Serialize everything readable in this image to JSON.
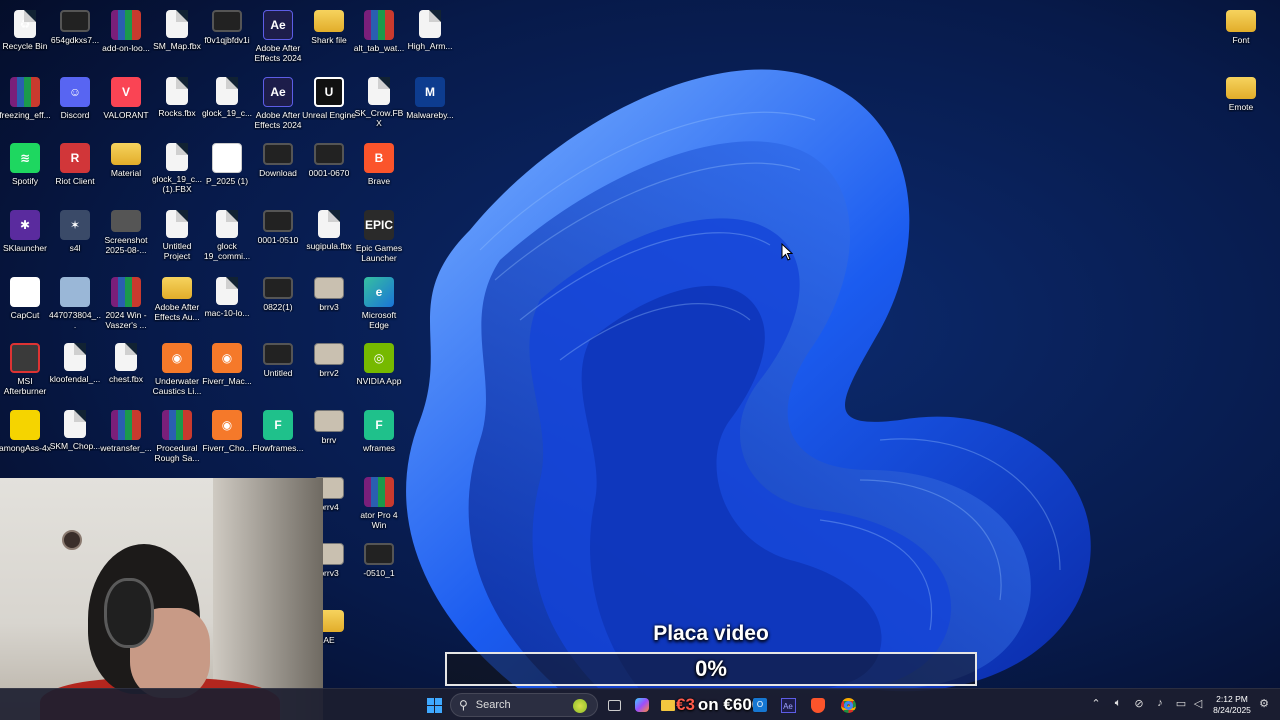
{
  "desktop": {
    "icons": [
      {
        "label": "Recycle Bin",
        "icon": "recycle-bin-icon",
        "type": "doc",
        "glyph": "♻"
      },
      {
        "label": "654gdkxs7...",
        "icon": "video-file-icon",
        "type": "video",
        "glyph": ""
      },
      {
        "label": "add-on-loo...",
        "icon": "winrar-icon",
        "type": "rar",
        "glyph": ""
      },
      {
        "label": "SM_Map.fbx",
        "icon": "file-icon",
        "type": "doc",
        "glyph": ""
      },
      {
        "label": "f0v1qjbfdv1i",
        "icon": "video-file-icon",
        "type": "video",
        "glyph": ""
      },
      {
        "label": "Adobe After Effects 2024",
        "icon": "after-effects-icon",
        "type": "ae",
        "glyph": "Ae"
      },
      {
        "label": "Shark file",
        "icon": "folder-icon",
        "type": "folder",
        "glyph": ""
      },
      {
        "label": "alt_tab_wat...",
        "icon": "winrar-icon",
        "type": "rar",
        "glyph": ""
      },
      {
        "label": "High_Arm...",
        "icon": "file-icon",
        "type": "doc",
        "glyph": ""
      },
      {
        "label": "freezing_eff...",
        "icon": "winrar-icon",
        "type": "rar",
        "glyph": ""
      },
      {
        "label": "Discord",
        "icon": "discord-icon",
        "type": "discord",
        "glyph": "☺"
      },
      {
        "label": "VALORANT",
        "icon": "valorant-icon",
        "type": "valorant",
        "glyph": "V"
      },
      {
        "label": "Rocks.fbx",
        "icon": "file-icon",
        "type": "doc",
        "glyph": ""
      },
      {
        "label": "glock_19_c...",
        "icon": "file-icon",
        "type": "doc",
        "glyph": ""
      },
      {
        "label": "Adobe After Effects 2024",
        "icon": "after-effects-icon",
        "type": "ae",
        "glyph": "Ae"
      },
      {
        "label": "Unreal Engine",
        "icon": "unreal-engine-icon",
        "type": "unreal",
        "glyph": "U"
      },
      {
        "label": "SK_Crow.FBX",
        "icon": "file-icon",
        "type": "doc",
        "glyph": ""
      },
      {
        "label": "Malwareby...",
        "icon": "malwarebytes-icon",
        "type": "malware",
        "glyph": "M"
      },
      {
        "label": "Spotify",
        "icon": "spotify-icon",
        "type": "spotify",
        "glyph": "≋"
      },
      {
        "label": "Riot Client",
        "icon": "riot-client-icon",
        "type": "riot",
        "glyph": "R"
      },
      {
        "label": "Material",
        "icon": "folder-icon",
        "type": "folder",
        "glyph": ""
      },
      {
        "label": "glock_19_c... (1).FBX",
        "icon": "file-icon",
        "type": "doc",
        "glyph": ""
      },
      {
        "label": "P_2025 (1)",
        "icon": "pdf-icon",
        "type": "pdf",
        "glyph": "▼"
      },
      {
        "label": "Download",
        "icon": "video-file-icon",
        "type": "video",
        "glyph": ""
      },
      {
        "label": "0001-0670",
        "icon": "video-file-icon",
        "type": "video",
        "glyph": ""
      },
      {
        "label": "Brave",
        "icon": "brave-icon",
        "type": "brave",
        "glyph": "B"
      },
      {
        "label": "SKlauncher",
        "icon": "sklauncher-icon",
        "type": "sklaunch",
        "glyph": "✱"
      },
      {
        "label": "s4l",
        "icon": "s4l-icon",
        "type": "s4l",
        "glyph": "✶"
      },
      {
        "label": "Screenshot 2025-08-...",
        "icon": "screenshot-icon",
        "type": "shot",
        "glyph": ""
      },
      {
        "label": "Untitled Project",
        "icon": "file-icon",
        "type": "doc",
        "glyph": ""
      },
      {
        "label": "glock 19_commi...",
        "icon": "file-icon",
        "type": "doc",
        "glyph": ""
      },
      {
        "label": "0001-0510",
        "icon": "video-file-icon",
        "type": "video",
        "glyph": ""
      },
      {
        "label": "sugipula.fbx",
        "icon": "file-icon",
        "type": "doc",
        "glyph": ""
      },
      {
        "label": "Epic Games Launcher",
        "icon": "epic-games-icon",
        "type": "epic",
        "glyph": "EPIC"
      },
      {
        "label": "CapCut",
        "icon": "capcut-icon",
        "type": "capcut",
        "glyph": "✂"
      },
      {
        "label": "447073804_...",
        "icon": "image-file-icon",
        "type": "photo",
        "glyph": ""
      },
      {
        "label": "2024 Win - Vaszer's ...",
        "icon": "winrar-icon",
        "type": "rar",
        "glyph": ""
      },
      {
        "label": "Adobe After Effects Au...",
        "icon": "folder-icon",
        "type": "folder",
        "glyph": ""
      },
      {
        "label": "mac-10-lo...",
        "icon": "file-icon",
        "type": "doc",
        "glyph": ""
      },
      {
        "label": "0822(1)",
        "icon": "video-file-icon",
        "type": "video",
        "glyph": ""
      },
      {
        "label": "brrv3",
        "icon": "image-thumb-icon",
        "type": "thumb",
        "glyph": ""
      },
      {
        "label": "Microsoft Edge",
        "icon": "edge-icon",
        "type": "edge",
        "glyph": "e"
      },
      {
        "label": "MSI Afterburner",
        "icon": "msi-afterburner-icon",
        "type": "msi",
        "glyph": ""
      },
      {
        "label": "kloofendal_...",
        "icon": "file-icon",
        "type": "doc",
        "glyph": ""
      },
      {
        "label": "chest.fbx",
        "icon": "file-icon",
        "type": "doc",
        "glyph": ""
      },
      {
        "label": "Underwater Caustics Li...",
        "icon": "blender-icon",
        "type": "blender",
        "glyph": "◉"
      },
      {
        "label": "Fiverr_Mac...",
        "icon": "blender-icon",
        "type": "blender",
        "glyph": "◉"
      },
      {
        "label": "Untitled",
        "icon": "video-file-icon",
        "type": "video",
        "glyph": ""
      },
      {
        "label": "brrv2",
        "icon": "image-thumb-icon",
        "type": "thumb",
        "glyph": ""
      },
      {
        "label": "NVIDIA App",
        "icon": "nvidia-icon",
        "type": "nvidia",
        "glyph": "◎"
      },
      {
        "label": "amongAss-4x",
        "icon": "among-us-icon",
        "type": "among",
        "glyph": ""
      },
      {
        "label": "SKM_Chop...",
        "icon": "file-icon",
        "type": "doc",
        "glyph": ""
      },
      {
        "label": "wetransfer_...",
        "icon": "winrar-icon",
        "type": "rar",
        "glyph": ""
      },
      {
        "label": "Procedural Rough Sa...",
        "icon": "winrar-icon",
        "type": "rar",
        "glyph": ""
      },
      {
        "label": "Fiverr_Cho...",
        "icon": "blender-icon",
        "type": "blender",
        "glyph": "◉"
      },
      {
        "label": "Flowframes...",
        "icon": "flowframes-icon",
        "type": "flow",
        "glyph": "F"
      },
      {
        "label": "brrv",
        "icon": "image-thumb-icon",
        "type": "thumb",
        "glyph": ""
      },
      {
        "label": "wframes",
        "icon": "flowframes-icon",
        "type": "flow",
        "glyph": "F"
      },
      {
        "label": "brrv4",
        "icon": "image-thumb-icon",
        "type": "thumb",
        "glyph": ""
      },
      {
        "label": "ator Pro 4 Win",
        "icon": "winrar-icon",
        "type": "rar",
        "glyph": ""
      },
      {
        "label": "brrv3",
        "icon": "image-thumb-icon",
        "type": "thumb",
        "glyph": ""
      },
      {
        "label": "-0510_1",
        "icon": "video-file-icon",
        "type": "video",
        "glyph": ""
      },
      {
        "label": "AE",
        "icon": "folder-icon",
        "type": "folder",
        "glyph": ""
      },
      {
        "label": "Font",
        "icon": "folder-icon",
        "type": "folder",
        "glyph": ""
      },
      {
        "label": "Emote",
        "icon": "folder-icon",
        "type": "folder",
        "glyph": ""
      }
    ]
  },
  "overlay": {
    "title": "Placa video",
    "progress_text": "0%",
    "progress_value": 0
  },
  "taskbar": {
    "search_label": "Search",
    "promo_red": "€3",
    "promo_text": "on €600",
    "clock_time": "2:12 PM",
    "clock_date": "8/24/2025"
  }
}
